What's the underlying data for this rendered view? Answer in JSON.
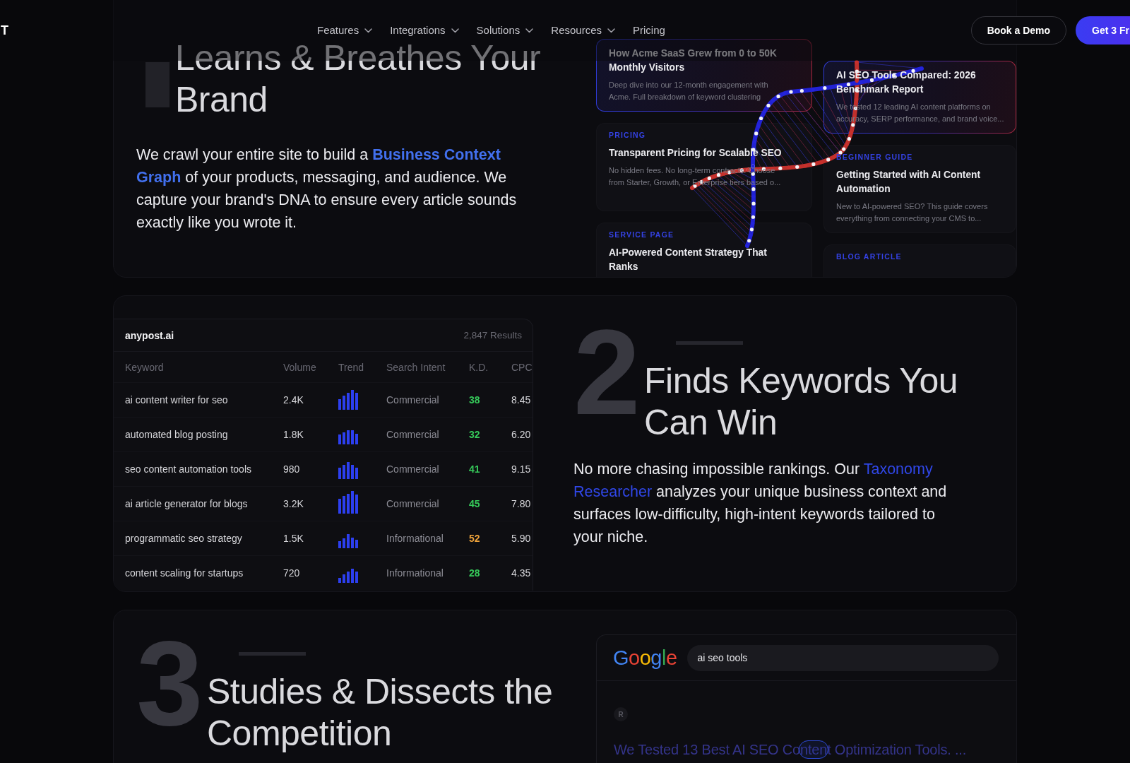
{
  "nav": {
    "logo": "T",
    "links": [
      {
        "label": "Features",
        "dropdown": true
      },
      {
        "label": "Integrations",
        "dropdown": true
      },
      {
        "label": "Solutions",
        "dropdown": true
      },
      {
        "label": "Resources",
        "dropdown": true
      },
      {
        "label": "Pricing",
        "dropdown": false
      }
    ],
    "buttons": [
      {
        "label": "Book a Demo",
        "kind": "outline"
      },
      {
        "label": "Get 3 Fr",
        "kind": "primary"
      }
    ]
  },
  "brand_section": {
    "heading": "Learns & Breathes Your Brand",
    "body": [
      {
        "text": "We crawl your entire site to build a ",
        "highlight": false
      },
      {
        "text": "**Business Context Graph**",
        "highlight": true
      },
      {
        "text": " of your products, messaging, and audience. We capture your brand's DNA to ensure every article sounds exactly like you wrote it.",
        "highlight": false
      }
    ],
    "card_columns": [
      {
        "cards": [
          {
            "title": "How Acme SaaS Grew from 0 to 50K Monthly Visitors",
            "description": "Deep dive into our 12-month engagement with Acme. Full breakdown of keyword clustering",
            "highlighted": true
          },
          {
            "label": "PRICING",
            "title": "Transparent Pricing for Scalable SEO",
            "description": "No hidden fees. No long-term contracts. Choose from Starter, Growth, or Enterprise tiers based o...",
            "highlighted": false
          },
          {
            "label": "SERVICE PAGE",
            "title": "AI-Powered Content Strategy That Ranks",
            "highlighted": false
          }
        ]
      },
      {
        "cards": [
          {
            "title": "AI SEO Tools Compared: 2026 Benchmark Report",
            "description": "We tested 12 leading AI content platforms on accuracy, SERP performance, and brand voice...",
            "highlighted": true
          },
          {
            "label": "BEGINNER GUIDE",
            "title": "Getting Started with AI Content Automation",
            "description": "New to AI-powered SEO? This guide covers everything from connecting your CMS to...",
            "highlighted": false
          },
          {
            "label": "BLOG ARTICLE",
            "highlighted": false
          }
        ]
      }
    ]
  },
  "keyword_section": {
    "step": "2",
    "heading": "Finds Keywords You Can Win",
    "body": [
      {
        "text": "No more chasing impossible rankings. Our ",
        "highlight": false
      },
      {
        "text": "Taxonomy Researcher",
        "highlight": true
      },
      {
        "text": " analyzes your unique business context and surfaces low-difficulty, high-intent keywords tailored to your niche.",
        "highlight": false
      }
    ],
    "table": {
      "site": "anypost.ai",
      "results": "2,847 Results",
      "columns": [
        "Keyword",
        "Volume",
        "Trend",
        "Search Intent",
        "K.D.",
        "CPC"
      ],
      "rows": [
        {
          "keyword": "ai content writer for seo",
          "volume": "2.4K",
          "intent": "Commercial",
          "kd": {
            "text": "38",
            "color": "#36c95a"
          },
          "cpc": "8.45"
        },
        {
          "keyword": "automated blog posting",
          "volume": "1.8K",
          "intent": "Commercial",
          "kd": {
            "text": "32",
            "color": "#36c95a"
          },
          "cpc": "6.20"
        },
        {
          "keyword": "seo content automation tools",
          "volume": "980",
          "intent": "Commercial",
          "kd": {
            "text": "41",
            "color": "#36c95a"
          },
          "cpc": "9.15"
        },
        {
          "keyword": "ai article generator for blogs",
          "volume": "3.2K",
          "intent": "Commercial",
          "kd": {
            "text": "45",
            "color": "#36c95a"
          },
          "cpc": "7.80"
        },
        {
          "keyword": "programmatic seo strategy",
          "volume": "1.5K",
          "intent": "Informational",
          "kd": {
            "text": "52",
            "color": "#eea23a"
          },
          "cpc": "5.90"
        },
        {
          "keyword": "content scaling for startups",
          "volume": "720",
          "intent": "Informational",
          "kd": {
            "text": "28",
            "color": "#36c95a"
          },
          "cpc": "4.35"
        }
      ]
    }
  },
  "competition_section": {
    "step": "3",
    "heading": "Studies & Dissects the Competition",
    "serp": {
      "logo": "Google",
      "query": "ai seo tools",
      "result": {
        "avatar": "R",
        "title": "We Tested 13 Best AI SEO Content Optimization Tools. ..."
      }
    }
  }
}
